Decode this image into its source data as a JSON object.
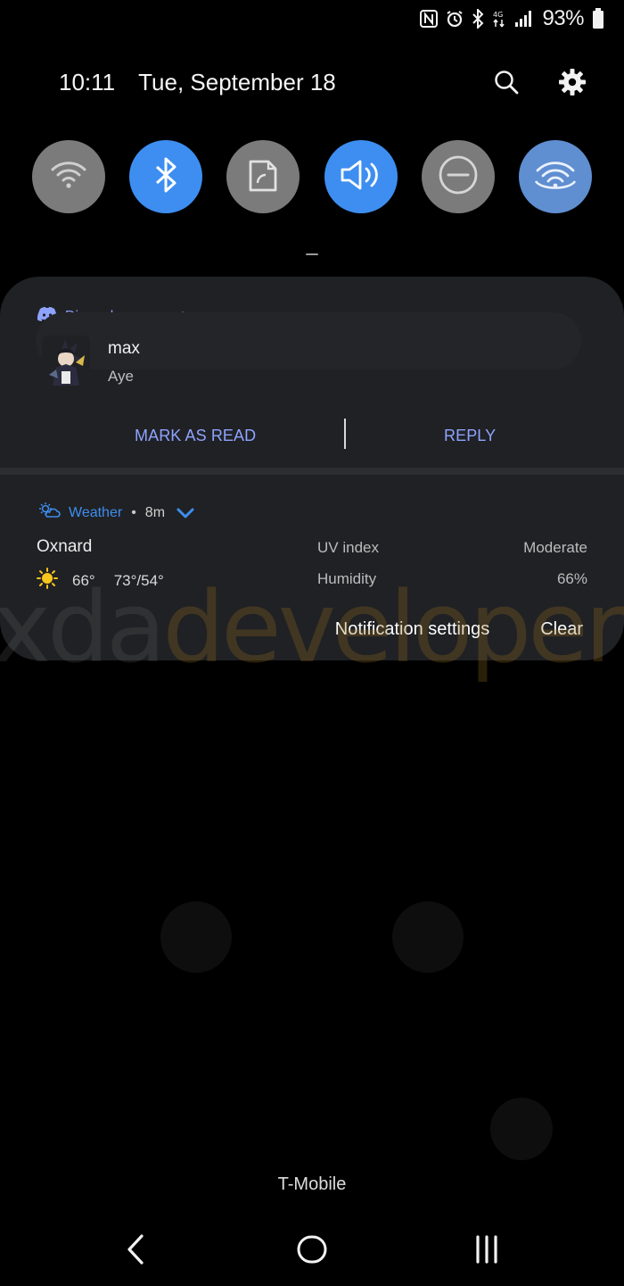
{
  "status_bar": {
    "battery_text": "93%",
    "icons": [
      "nfc-icon",
      "alarm-icon",
      "bluetooth-icon",
      "data-icon",
      "signal-icon",
      "battery-icon"
    ]
  },
  "header": {
    "time": "10:11",
    "date": "Tue, September 18",
    "actions": [
      "search-icon",
      "settings-icon"
    ]
  },
  "quick_settings": [
    {
      "name": "wifi",
      "state": "off"
    },
    {
      "name": "bluetooth",
      "state": "on"
    },
    {
      "name": "auto-rotate",
      "state": "off"
    },
    {
      "name": "sound",
      "state": "on"
    },
    {
      "name": "do-not-disturb",
      "state": "off"
    },
    {
      "name": "mobile-hotspot",
      "state": "on"
    }
  ],
  "notifications": {
    "discord": {
      "app_name": "Discord",
      "time": "now",
      "sender": "max",
      "message": "Aye",
      "actions": {
        "mark_read": "MARK AS READ",
        "reply": "REPLY"
      }
    },
    "weather": {
      "app_name": "Weather",
      "time": "8m",
      "city": "Oxnard",
      "current_temp": "66°",
      "range": "73°/54°",
      "uv_label": "UV index",
      "uv_value": "Moderate",
      "humidity_label": "Humidity",
      "humidity_value": "66%"
    }
  },
  "panel_footer": {
    "settings_label": "Notification settings",
    "clear_label": "Clear"
  },
  "watermark": {
    "part_a": "xda",
    "part_b": "developers"
  },
  "carrier": "T-Mobile",
  "colors": {
    "accent_blue": "#3d8ef0",
    "discord_blue": "#8ea3ff",
    "panel_bg": "#202124",
    "tile_off": "#7b7b7b"
  }
}
